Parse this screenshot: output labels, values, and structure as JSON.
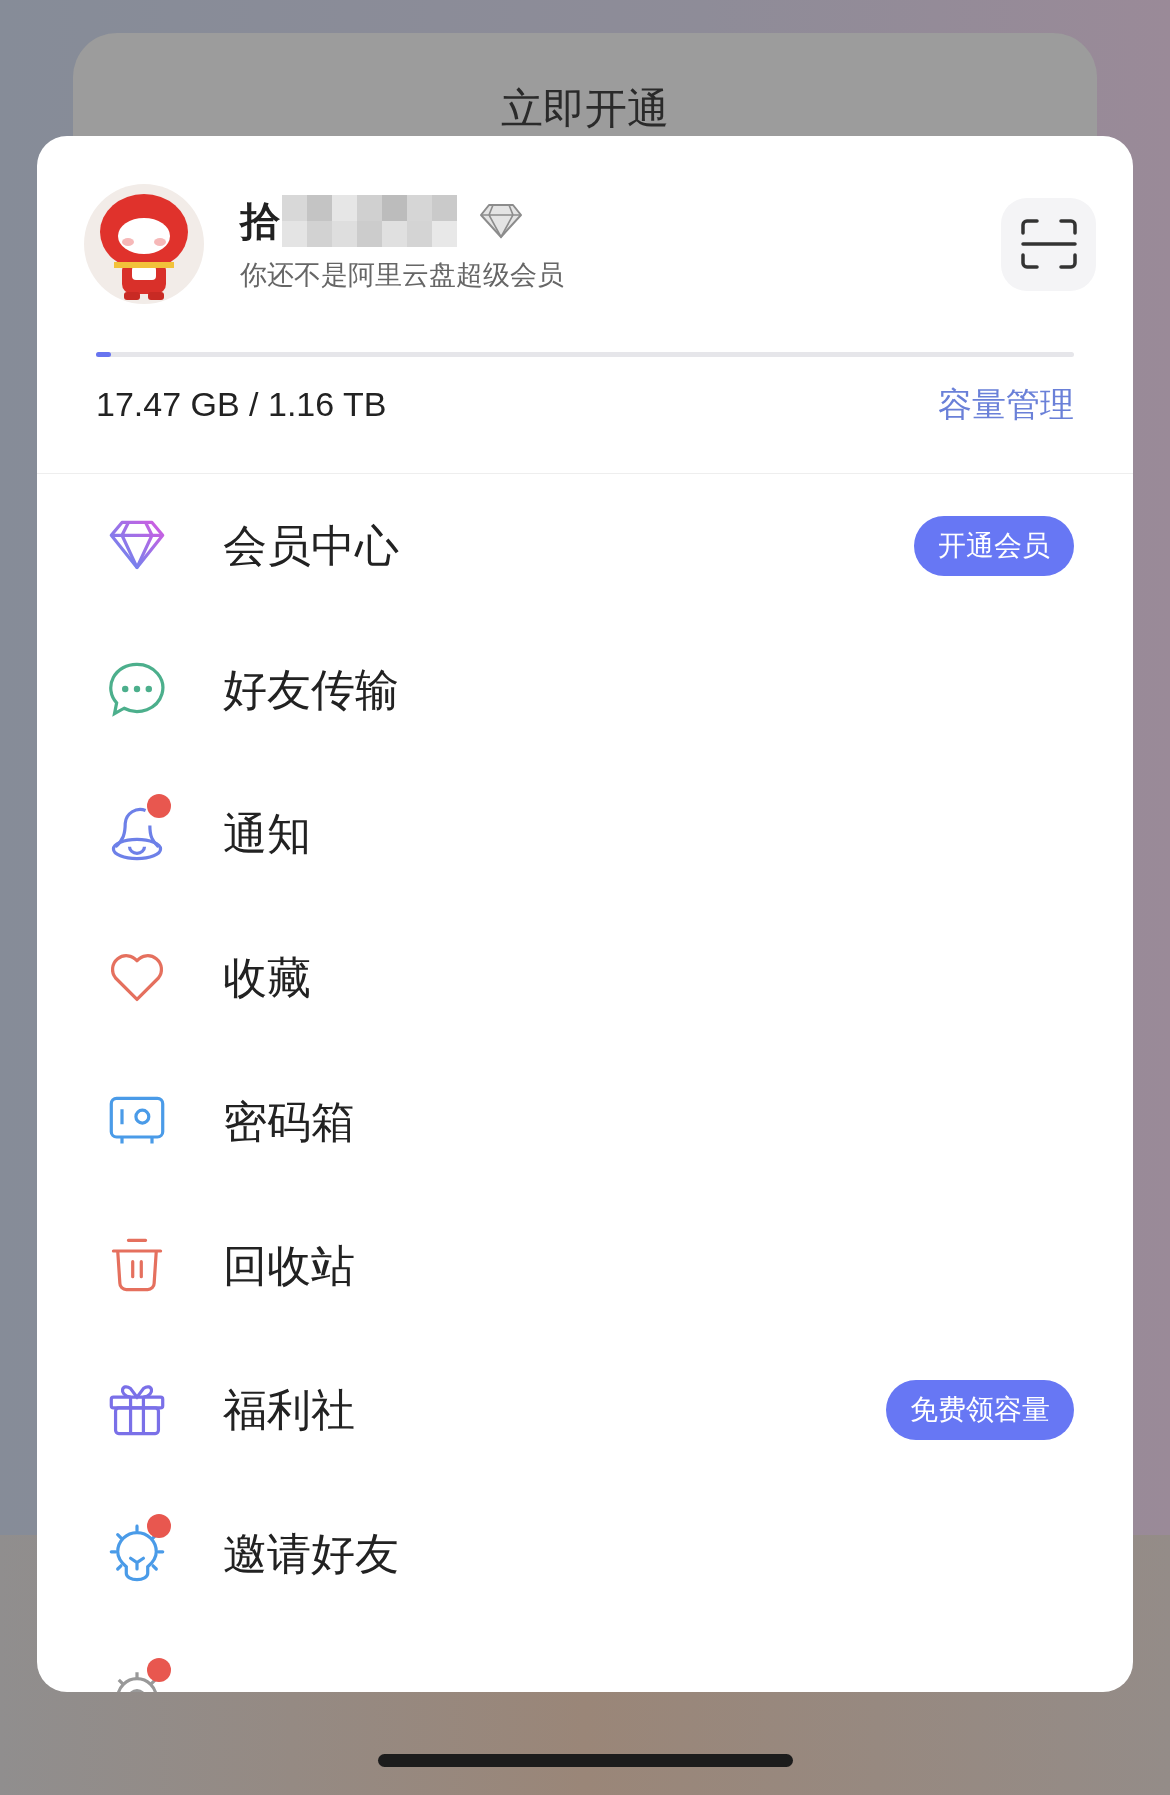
{
  "background": {
    "button": "立即开通"
  },
  "profile": {
    "name": "拾",
    "subtitle": "你还不是阿里云盘超级会员"
  },
  "storage": {
    "level": 0.015,
    "usage": "17.47 GB / 1.16 TB",
    "link": "容量管理"
  },
  "menu": [
    {
      "label": "会员中心",
      "dot": false,
      "badge": "开通会员"
    },
    {
      "label": "好友传输",
      "dot": false
    },
    {
      "label": "通知",
      "dot": true
    },
    {
      "label": "收藏",
      "dot": false
    },
    {
      "label": "密码箱",
      "dot": false
    },
    {
      "label": "回收站",
      "dot": false
    },
    {
      "label": "福利社",
      "dot": false,
      "badge": "免费领容量"
    },
    {
      "label": "邀请好友",
      "dot": true
    },
    {
      "dot": true
    }
  ]
}
